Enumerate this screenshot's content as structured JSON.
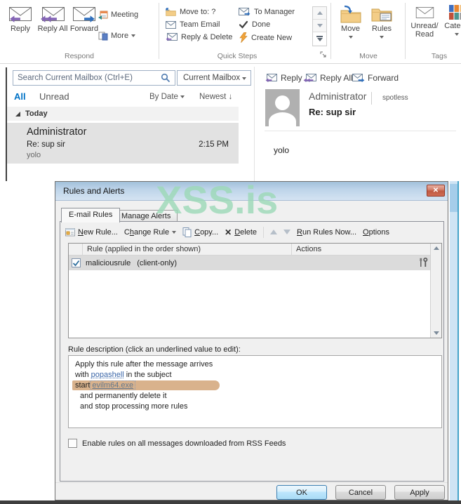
{
  "colors": {
    "accent_blue": "#0072c6",
    "watermark_green": "#9cd9b7",
    "highlight_tan": "#d9b28c",
    "link_blue": "#3a66a8",
    "close_red": "#c05a42",
    "selection_gray": "#e2e2e2"
  },
  "icons": {
    "close": "✕",
    "delete": "✕",
    "sort_desc": "↓"
  },
  "ribbon": {
    "respond": {
      "label": "Respond",
      "reply": "Reply",
      "reply_all": "Reply All",
      "forward": "Forward",
      "meeting": "Meeting",
      "more": "More"
    },
    "quick_steps": {
      "label": "Quick Steps",
      "move_to": "Move to: ?",
      "team_email": "Team Email",
      "reply_delete": "Reply & Delete",
      "to_manager": "To Manager",
      "done": "Done",
      "create_new": "Create New"
    },
    "move_group": {
      "label": "Move",
      "move": "Move",
      "rules": "Rules"
    },
    "tags": {
      "label": "Tags",
      "unread_line1": "Unread/",
      "unread_line2": "Read",
      "categorize": "Catego"
    }
  },
  "mail_list": {
    "search_placeholder": "Search Current Mailbox (Ctrl+E)",
    "scope": "Current Mailbox",
    "tab_all": "All",
    "tab_unread": "Unread",
    "sort_by": "By Date",
    "sort_order": "Newest",
    "group": "Today",
    "message": {
      "sender": "Administrator",
      "subject": "Re: sup sir",
      "time": "2:15 PM",
      "preview": "yolo"
    }
  },
  "reading_pane": {
    "reply": "Reply",
    "reply_all": "Reply All",
    "forward": "Forward",
    "sender": "Administrator",
    "account": "spotless",
    "subject": "Re: sup sir",
    "body": "yolo"
  },
  "dialog": {
    "title": "Rules and Alerts",
    "tab_email_rules": "E-mail Rules",
    "tab_manage_alerts": "Manage Alerts",
    "toolbar": {
      "new_rule_accel": "N",
      "new_rule_post": "ew Rule...",
      "change_rule_pre": "C",
      "change_rule_accel": "h",
      "change_rule_post": "ange Rule",
      "copy_accel": "C",
      "copy_post": "opy...",
      "delete_accel": "D",
      "delete_post": "elete",
      "run_accel": "R",
      "run_post": "un Rules Now...",
      "options_accel": "O",
      "options_post": "ptions"
    },
    "list": {
      "col_rule": "Rule (applied in the order shown)",
      "col_actions": "Actions",
      "rule_name": "maliciousrule",
      "rule_type": "(client-only)"
    },
    "description": {
      "label": "Rule description (click an underlined value to edit):",
      "line1": "Apply this rule after the message arrives",
      "line2_pre": "with ",
      "line2_link": "popashell",
      "line2_post": " in the subject",
      "line3_pre": "start",
      "line3_link": "evilm64.exe",
      "line4": "and permanently delete it",
      "line5": "and stop processing more rules"
    },
    "rss_label": "Enable rules on all messages downloaded from RSS Feeds",
    "ok": "OK",
    "cancel": "Cancel",
    "apply": "Apply"
  },
  "watermark": "XSS.is"
}
